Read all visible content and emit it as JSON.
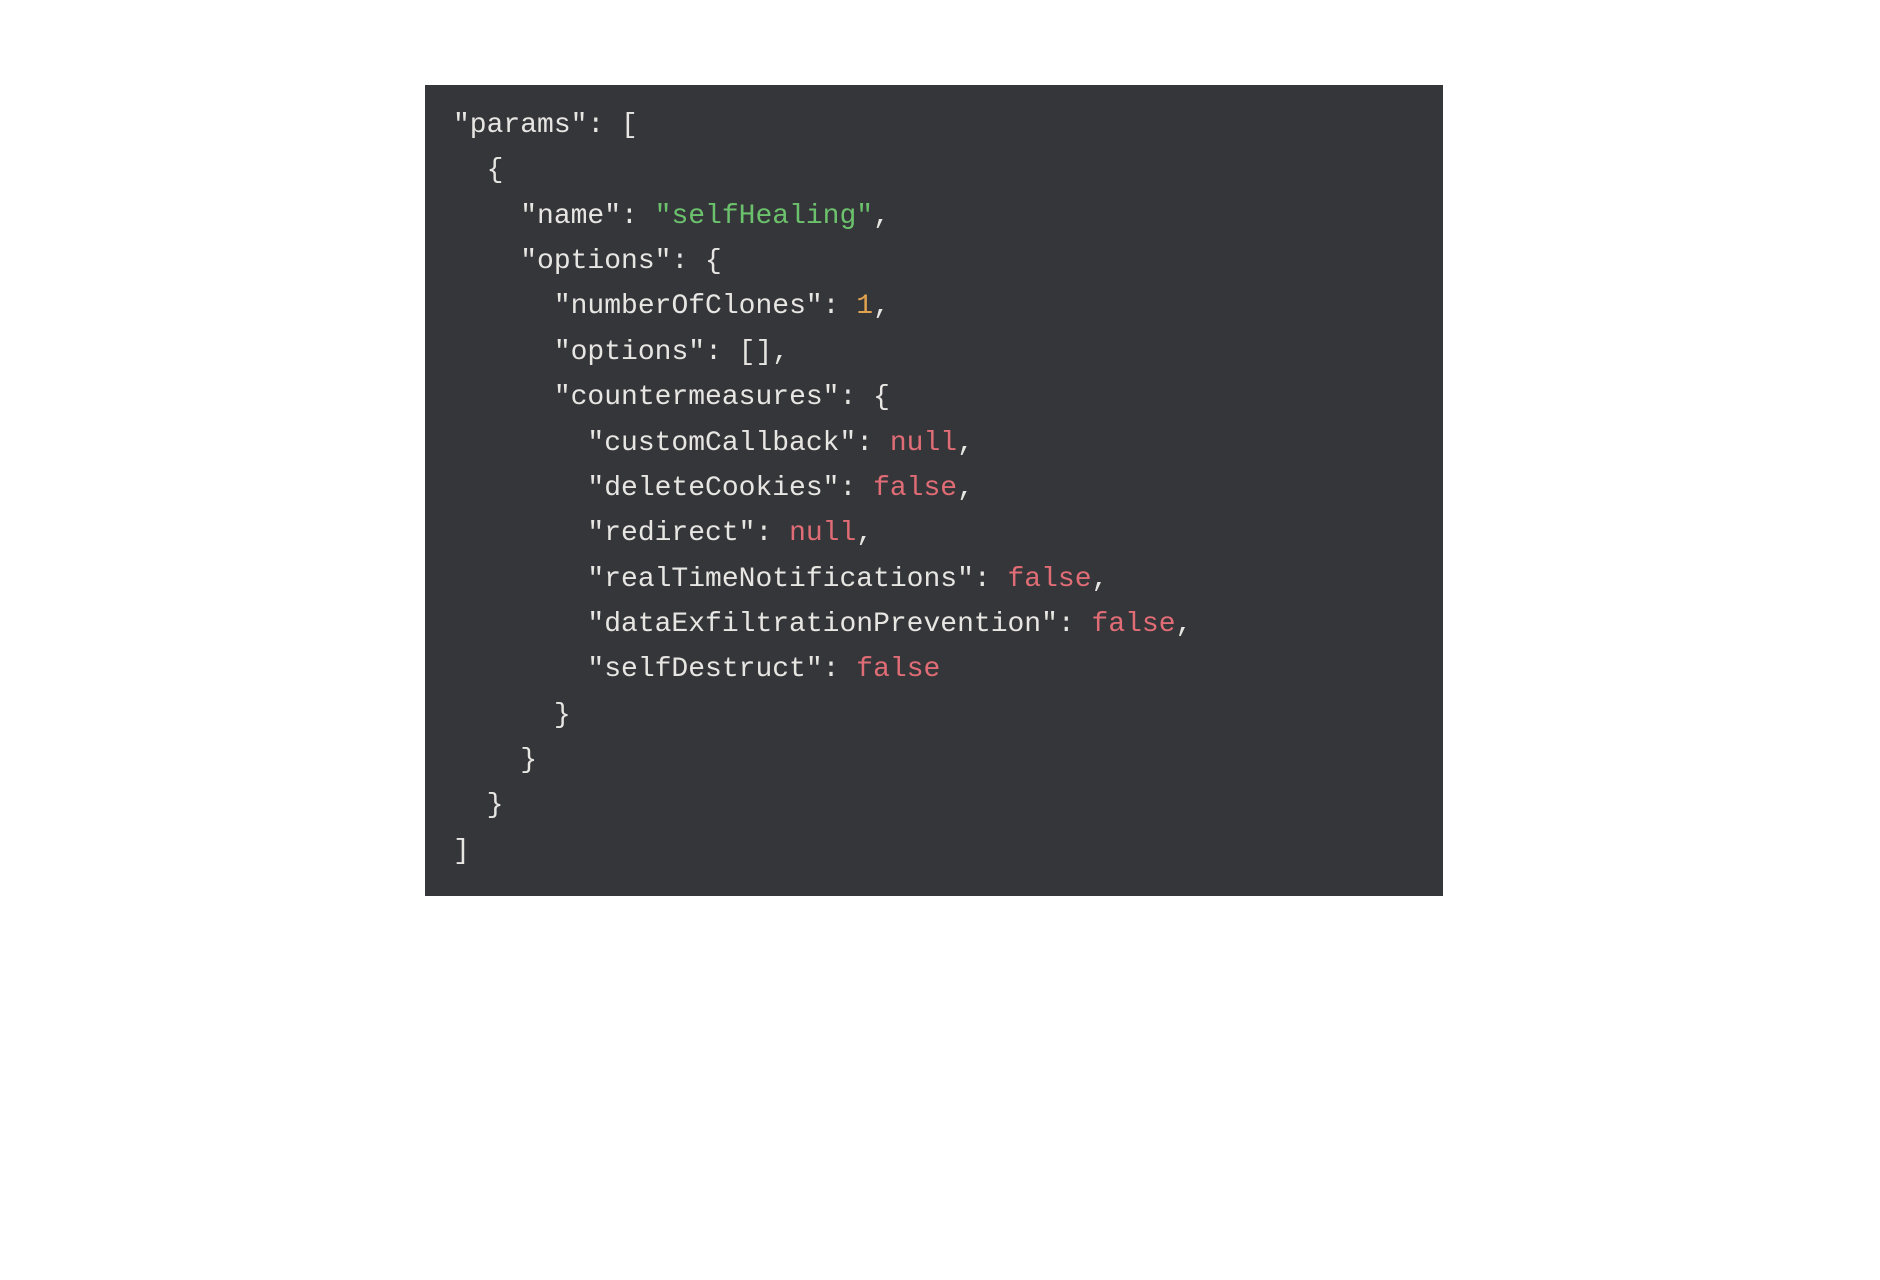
{
  "code": {
    "rootKey": "\"params\"",
    "nameKey": "\"name\"",
    "nameVal": "\"selfHealing\"",
    "optionsKey": "\"options\"",
    "numClonesKey": "\"numberOfClones\"",
    "numClonesVal": "1",
    "innerOptionsKey": "\"options\"",
    "innerOptionsVal": "[]",
    "counterKey": "\"countermeasures\"",
    "cbKey": "\"customCallback\"",
    "cbVal": "null",
    "cookiesKey": "\"deleteCookies\"",
    "cookiesVal": "false",
    "redirectKey": "\"redirect\"",
    "redirectVal": "null",
    "rtnKey": "\"realTimeNotifications\"",
    "rtnVal": "false",
    "depKey": "\"dataExfiltrationPrevention\"",
    "depVal": "false",
    "sdKey": "\"selfDestruct\"",
    "sdVal": "false"
  }
}
